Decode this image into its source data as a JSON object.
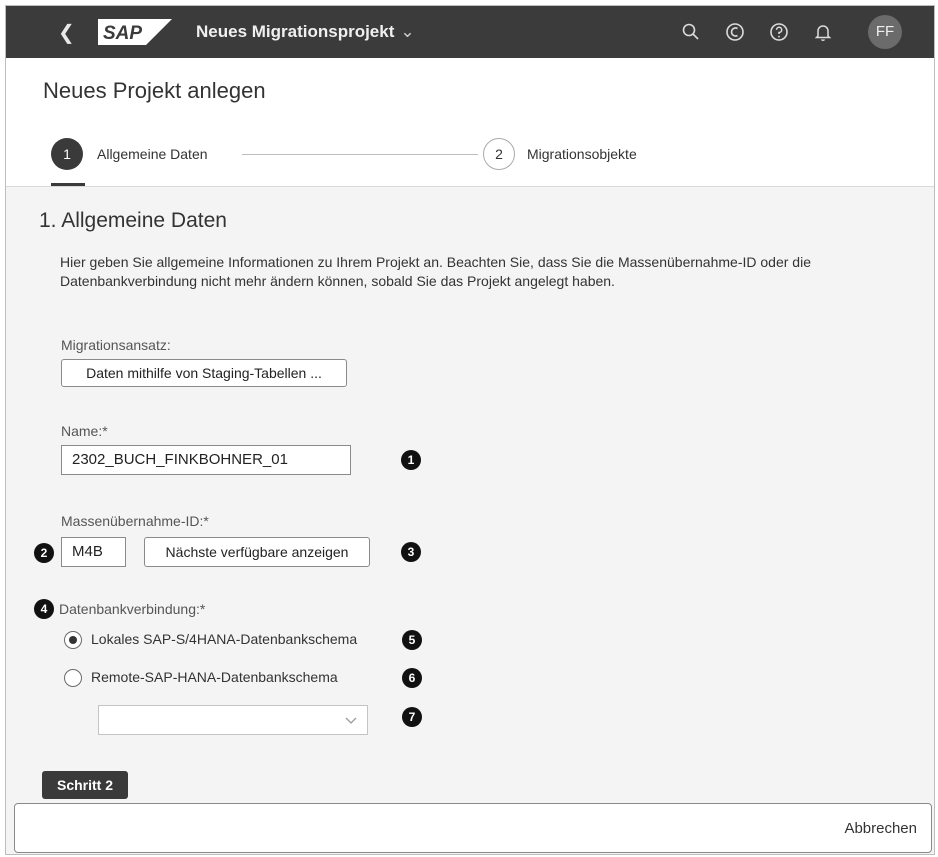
{
  "shell": {
    "logo_text": "SAP",
    "app_title": "Neues Migrationsprojekt",
    "user_initials": "FF",
    "icons": [
      "back-icon",
      "search-icon",
      "copilot-icon",
      "help-icon",
      "notification-icon"
    ]
  },
  "header": {
    "title": "Neues Projekt anlegen",
    "steps": [
      {
        "number": "1",
        "label": "Allgemeine Daten",
        "active": true
      },
      {
        "number": "2",
        "label": "Migrationsobjekte",
        "active": false
      }
    ]
  },
  "section": {
    "title": "1. Allgemeine Daten",
    "description": "Hier geben Sie allgemeine Informationen zu Ihrem Projekt an. Beachten Sie, dass Sie die Massenübernahme-ID oder die Datenbankverbindung nicht mehr ändern können, sobald Sie das Projekt angelegt haben."
  },
  "form": {
    "approach_label": "Migrationsansatz:",
    "approach_value": "Daten mithilfe von Staging-Tabellen ...",
    "name_label": "Name:*",
    "name_value": "2302_BUCH_FINKBOHNER_01",
    "transfer_id_label": "Massenübernahme-ID:*",
    "transfer_id_value": "M4B",
    "next_available_button": "Nächste verfügbare anzeigen",
    "db_label": "Datenbankverbindung:*",
    "db_options": [
      {
        "label": "Lokales SAP-S/4HANA-Datenbankschema",
        "selected": true
      },
      {
        "label": "Remote-SAP-HANA-Datenbankschema",
        "selected": false
      }
    ],
    "db_select_value": ""
  },
  "markers": [
    "1",
    "2",
    "3",
    "4",
    "5",
    "6",
    "7"
  ],
  "next_step_button": "Schritt 2",
  "footer": {
    "cancel_button": "Abbrechen"
  },
  "colors": {
    "shell_bg": "#3b3b3b",
    "accent_dark": "#3a3a3a",
    "content_bg": "#f4f4f4"
  }
}
